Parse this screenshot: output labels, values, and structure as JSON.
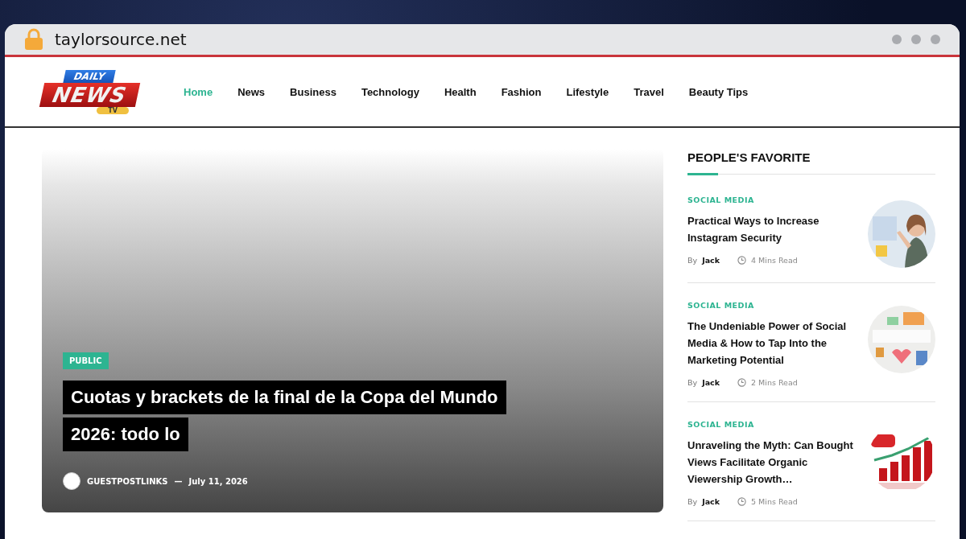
{
  "browser": {
    "url": "taylorsource.net"
  },
  "logo": {
    "top": "DAILY",
    "main": "NEWS",
    "sub": "TV"
  },
  "nav": [
    {
      "label": "Home",
      "selected": true
    },
    {
      "label": "News",
      "selected": false
    },
    {
      "label": "Business",
      "selected": false
    },
    {
      "label": "Technology",
      "selected": false
    },
    {
      "label": "Health",
      "selected": false
    },
    {
      "label": "Fashion",
      "selected": false
    },
    {
      "label": "Lifestyle",
      "selected": false
    },
    {
      "label": "Travel",
      "selected": false
    },
    {
      "label": "Beauty Tips",
      "selected": false
    }
  ],
  "hero": {
    "category": "PUBLIC",
    "title_lines": [
      "Cuotas y brackets de la final de la Copa del Mundo",
      "2026: todo lo"
    ],
    "author": "GUESTPOSTLINKS",
    "separator": "—",
    "date": "July 11, 2026"
  },
  "sidebar": {
    "title": "PEOPLE'S FAVORITE",
    "posts": [
      {
        "category": "SOCIAL MEDIA",
        "title": "Practical Ways to Increase Instagram Security",
        "by": "By",
        "author": "Jack",
        "read": "4 Mins Read",
        "kind": "picture"
      },
      {
        "category": "SOCIAL MEDIA",
        "title": "The Undeniable Power of Social Media & How to Tap Into the Marketing Potential",
        "by": "By",
        "author": "Jack",
        "read": "2 Mins Read",
        "kind": "picture"
      },
      {
        "category": "SOCIAL MEDIA",
        "title": "Unraveling the Myth: Can Bought Views Facilitate Organic Viewership Growth…",
        "by": "By",
        "author": "Jack",
        "read": "5 Mins Read",
        "kind": "picture"
      }
    ]
  }
}
